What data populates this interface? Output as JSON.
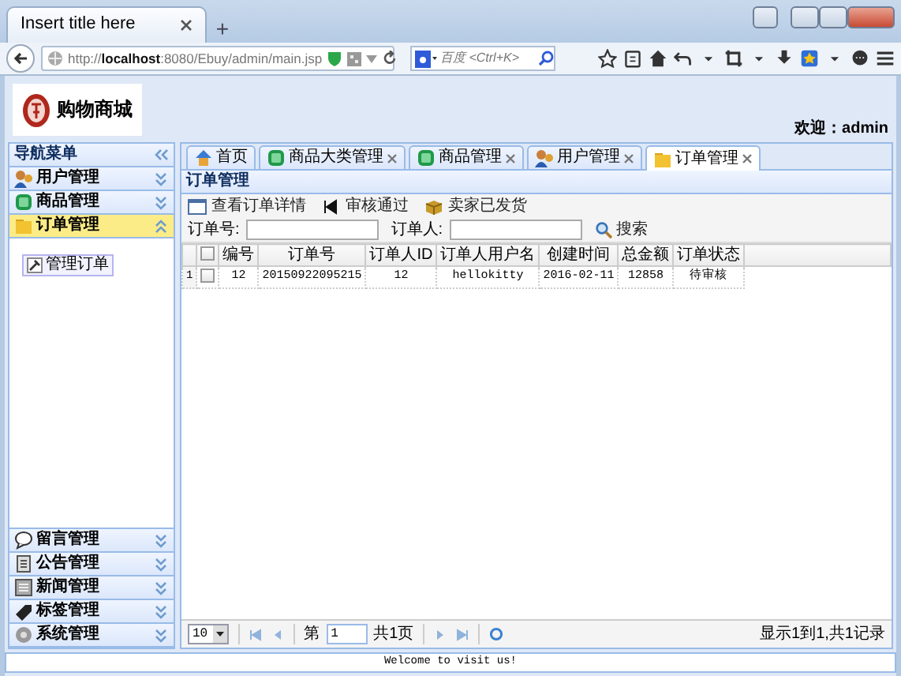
{
  "browser": {
    "tab_title": "Insert title here",
    "new_tab": "+",
    "url": "http://**localhost**:8080/Ebuy/admin/main.jsp",
    "search_placeholder": "百度 <Ctrl+K>"
  },
  "header": {
    "logo_text": "购物商城",
    "welcome": "欢迎：admin"
  },
  "sidebar": {
    "title": "导航菜单",
    "sections": [
      {
        "label": "用户管理",
        "expanded": false
      },
      {
        "label": "商品管理",
        "expanded": false
      },
      {
        "label": "订单管理",
        "expanded": true,
        "children": [
          {
            "label": "管理订单"
          }
        ]
      },
      {
        "label": "留言管理",
        "expanded": false
      },
      {
        "label": "公告管理",
        "expanded": false
      },
      {
        "label": "新闻管理",
        "expanded": false
      },
      {
        "label": "标签管理",
        "expanded": false
      },
      {
        "label": "系统管理",
        "expanded": false
      }
    ]
  },
  "tabs": [
    {
      "label": "首页",
      "closable": false,
      "selected": false
    },
    {
      "label": "商品大类管理",
      "closable": true,
      "selected": false
    },
    {
      "label": "商品管理",
      "closable": true,
      "selected": false
    },
    {
      "label": "用户管理",
      "closable": true,
      "selected": false
    },
    {
      "label": "订单管理",
      "closable": true,
      "selected": true
    }
  ],
  "panel_title": "订单管理",
  "toolbar": [
    "查看订单详情",
    "审核通过",
    "卖家已发货"
  ],
  "filters": [
    {
      "label": "订单号:"
    },
    {
      "label": "订单人:"
    }
  ],
  "search_button": "搜索",
  "table": {
    "header_checked": false,
    "columns": [
      "编号",
      "订单号",
      "订单人ID",
      "订单人用户名",
      "创建时间",
      "总金额",
      "订单状态"
    ],
    "rows": [
      {
        "number": "1",
        "checked": false,
        "cells": [
          "12",
          "20150922095215",
          "12",
          "hellokitty",
          "2016-02-11",
          "12858",
          "待审核"
        ]
      }
    ]
  },
  "pager": {
    "page_size": "10",
    "page_prefix": "第",
    "page": "1",
    "page_total": "共1页",
    "info": "显示1到1,共1记录"
  },
  "footer": "Welcome to visit us!"
}
